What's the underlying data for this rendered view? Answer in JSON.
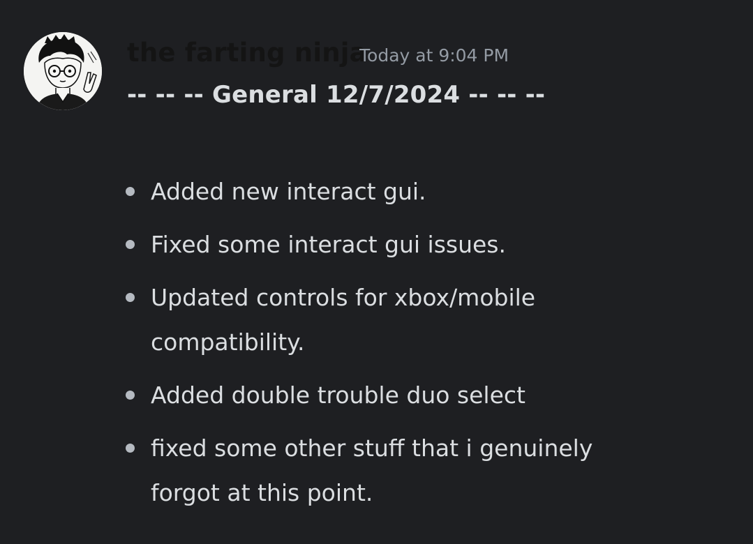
{
  "message": {
    "author": "the farting ninja",
    "timestamp": "Today at 9:04 PM",
    "heading": "-- -- -- General 12/7/2024 -- -- --",
    "items": [
      "Added new interact gui.",
      "Fixed some interact gui issues.",
      "Updated controls for xbox/mobile compatibility.",
      "Added double trouble duo select",
      "fixed some other stuff that i genuinely forgot at this point."
    ]
  },
  "colors": {
    "background": "#1e1f22",
    "text": "#dbdee1",
    "timestamp": "#949ba4",
    "username": "#141414",
    "bullet": "#b5bac1"
  },
  "avatar": {
    "icon": "avatar-icon"
  }
}
